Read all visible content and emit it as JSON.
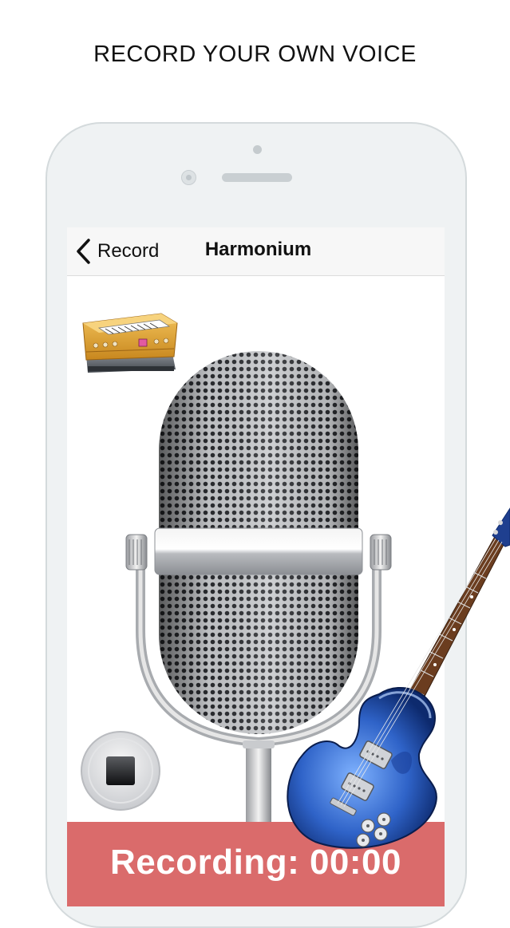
{
  "headline": "RECORD YOUR OWN VOICE",
  "navbar": {
    "back_label": "Record",
    "title": "Harmonium"
  },
  "recording": {
    "label": "Recording: 00:00"
  },
  "icons": {
    "back": "chevron-left-icon",
    "instrument": "harmonium-icon",
    "microphone": "microphone-icon",
    "stop": "stop-icon",
    "guitar": "electric-guitar-icon"
  },
  "colors": {
    "recording_bar": "#da6b6b",
    "phone_frame": "#eff2f3",
    "guitar_body": "#2d5fc4"
  }
}
